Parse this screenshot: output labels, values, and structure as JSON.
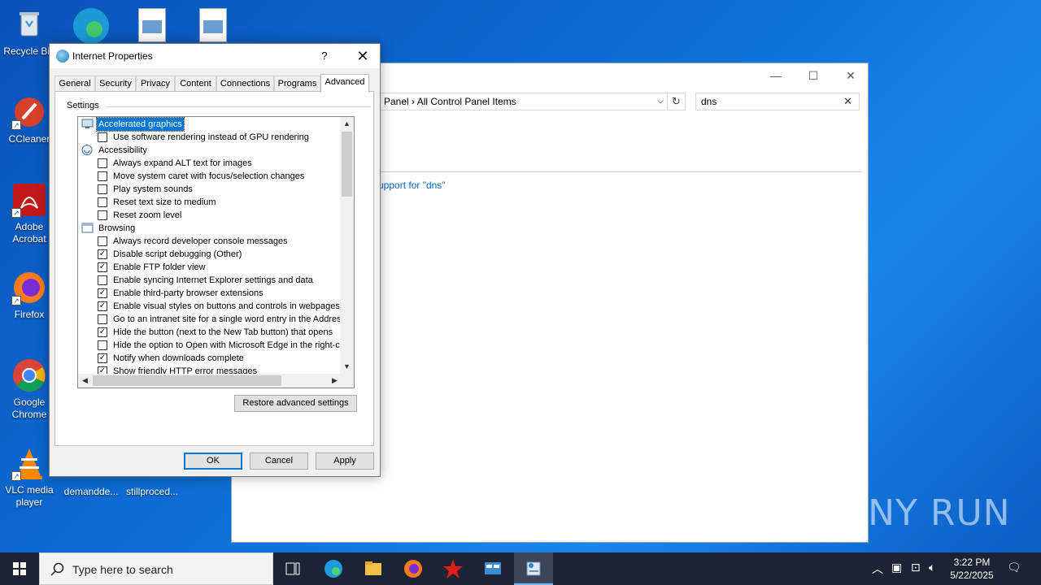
{
  "desktop": {
    "icons": [
      {
        "label": "Recycle Bin",
        "icon": "recycle-bin-icon"
      },
      {
        "label": "CCleaner",
        "icon": "ccleaner-icon"
      },
      {
        "label": "Adobe Acrobat",
        "icon": "adobe-acrobat-icon"
      },
      {
        "label": "Firefox",
        "icon": "firefox-icon"
      },
      {
        "label": "Google Chrome",
        "icon": "chrome-icon"
      },
      {
        "label": "VLC media player",
        "icon": "vlc-icon"
      },
      {
        "label": "demandde...",
        "icon": "file-icon"
      },
      {
        "label": "stillproced...",
        "icon": "file-icon"
      }
    ]
  },
  "control_panel": {
    "address": "l Panel  ›  All Control Panel Items",
    "search_value": "dns",
    "link": "upport for \"dns\"",
    "buttons": {
      "minimize": "—",
      "maximize": "☐",
      "close": "✕"
    }
  },
  "dialog": {
    "title": "Internet Properties",
    "help": "?",
    "close": "✕",
    "tabs": [
      "General",
      "Security",
      "Privacy",
      "Content",
      "Connections",
      "Programs",
      "Advanced"
    ],
    "active_tab": "Advanced",
    "group_label": "Settings",
    "tree": [
      {
        "type": "category",
        "label": "Accelerated graphics",
        "icon": "monitor-icon",
        "selected": true
      },
      {
        "type": "check",
        "label": "Use software rendering instead of GPU rendering",
        "checked": false
      },
      {
        "type": "category",
        "label": "Accessibility",
        "icon": "accessibility-icon",
        "selected": false
      },
      {
        "type": "check",
        "label": "Always expand ALT text for images",
        "checked": false
      },
      {
        "type": "check",
        "label": "Move system caret with focus/selection changes",
        "checked": false
      },
      {
        "type": "check",
        "label": "Play system sounds",
        "checked": false
      },
      {
        "type": "check",
        "label": "Reset text size to medium",
        "checked": false
      },
      {
        "type": "check",
        "label": "Reset zoom level",
        "checked": false
      },
      {
        "type": "category",
        "label": "Browsing",
        "icon": "browser-window-icon",
        "selected": false
      },
      {
        "type": "check",
        "label": "Always record developer console messages",
        "checked": false
      },
      {
        "type": "check",
        "label": "Disable script debugging (Other)",
        "checked": true
      },
      {
        "type": "check",
        "label": "Enable FTP folder view",
        "checked": true
      },
      {
        "type": "check",
        "label": "Enable syncing Internet Explorer settings and data",
        "checked": false
      },
      {
        "type": "check",
        "label": "Enable third-party browser extensions",
        "checked": true
      },
      {
        "type": "check",
        "label": "Enable visual styles on buttons and controls in webpages",
        "checked": true
      },
      {
        "type": "check",
        "label": "Go to an intranet site for a single word entry in the Addres",
        "checked": false
      },
      {
        "type": "check",
        "label": "Hide the button (next to the New Tab button) that opens",
        "checked": true
      },
      {
        "type": "check",
        "label": "Hide the option to Open with Microsoft Edge in the right-cl",
        "checked": false
      },
      {
        "type": "check",
        "label": "Notify when downloads complete",
        "checked": true
      },
      {
        "type": "check",
        "label": "Show friendly HTTP error messages",
        "checked": true
      }
    ],
    "restore_button": "Restore advanced settings",
    "ok": "OK",
    "cancel": "Cancel",
    "apply": "Apply"
  },
  "taskbar": {
    "search_placeholder": "Type here to search",
    "time": "3:22 PM",
    "date": "5/22/2025",
    "items": [
      "task-view-icon",
      "edge-icon",
      "file-explorer-icon",
      "firefox-icon",
      "star-app-icon",
      "control-panel-icon",
      "internet-properties-icon"
    ]
  },
  "watermark": "ANY RUN"
}
